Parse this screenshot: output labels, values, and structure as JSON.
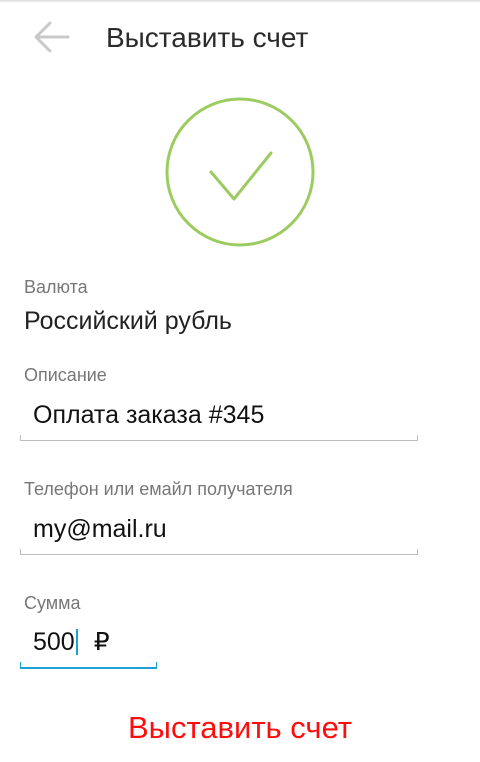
{
  "header": {
    "title": "Выставить счет",
    "back_icon": "arrow-left-icon"
  },
  "status": {
    "icon": "checkmark-circle-icon",
    "color": "#9ccb5f"
  },
  "currency": {
    "label": "Валюта",
    "value": "Российский рубль"
  },
  "description": {
    "label": "Описание",
    "value": "Оплата заказа #345"
  },
  "recipient": {
    "label": "Телефон или емайл получателя",
    "value": "my@mail.ru"
  },
  "amount": {
    "label": "Сумма",
    "value": "500",
    "currency_symbol": "₽",
    "focused": true
  },
  "submit": {
    "label": "Выставить счет",
    "color": "#ff0d0d"
  },
  "colors": {
    "accent": "#1ea0d6",
    "label": "#777777"
  }
}
